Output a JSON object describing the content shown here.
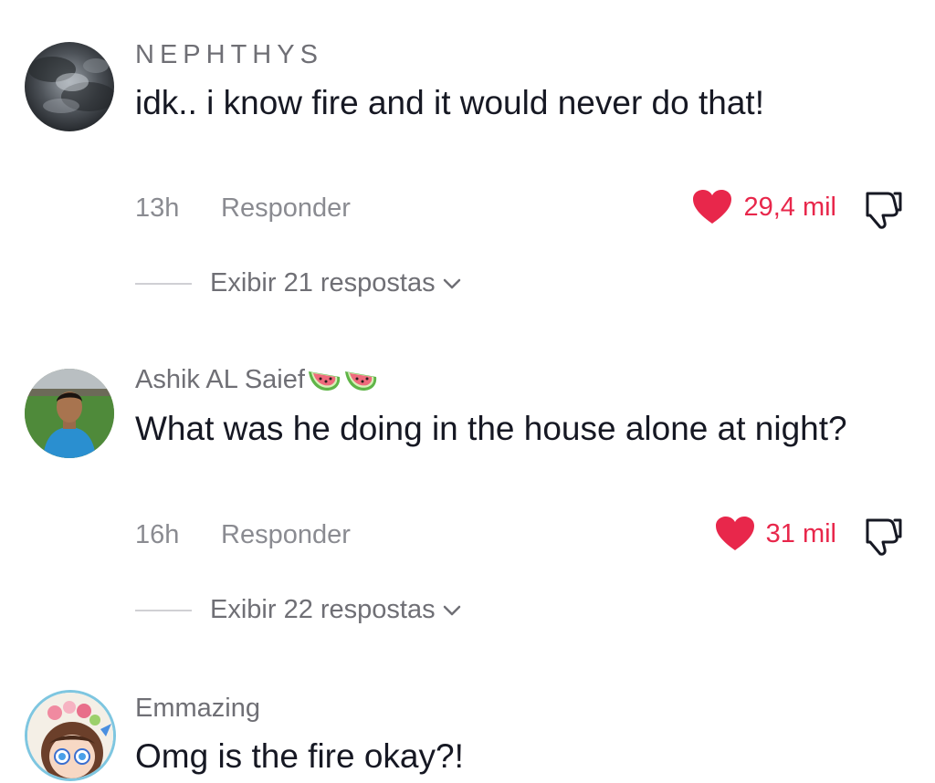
{
  "comments": [
    {
      "username": "NEPHTHYS",
      "text": "idk.. i know fire and it would never do that!",
      "time": "13h",
      "reply_label": "Responder",
      "likes": "29,4 mil",
      "view_replies": "Exibir 21 respostas",
      "avatar_icon": "storm-cloud-avatar"
    },
    {
      "username": "Ashik AL Saief",
      "username_emoji": [
        "watermelon-icon",
        "watermelon-icon"
      ],
      "text": "What was he doing in the house alone at night?",
      "time": "16h",
      "reply_label": "Responder",
      "likes": "31 mil",
      "view_replies": "Exibir 22 respostas",
      "avatar_icon": "man-photo-avatar"
    },
    {
      "username": "Emmazing",
      "text": "Omg is the fire okay?!",
      "avatar_icon": "cartoon-girl-avatar"
    }
  ],
  "colors": {
    "like_red": "#e8274b",
    "meta_gray": "#8a8b91",
    "username_gray": "#6f6f75",
    "text_dark": "#161823"
  }
}
